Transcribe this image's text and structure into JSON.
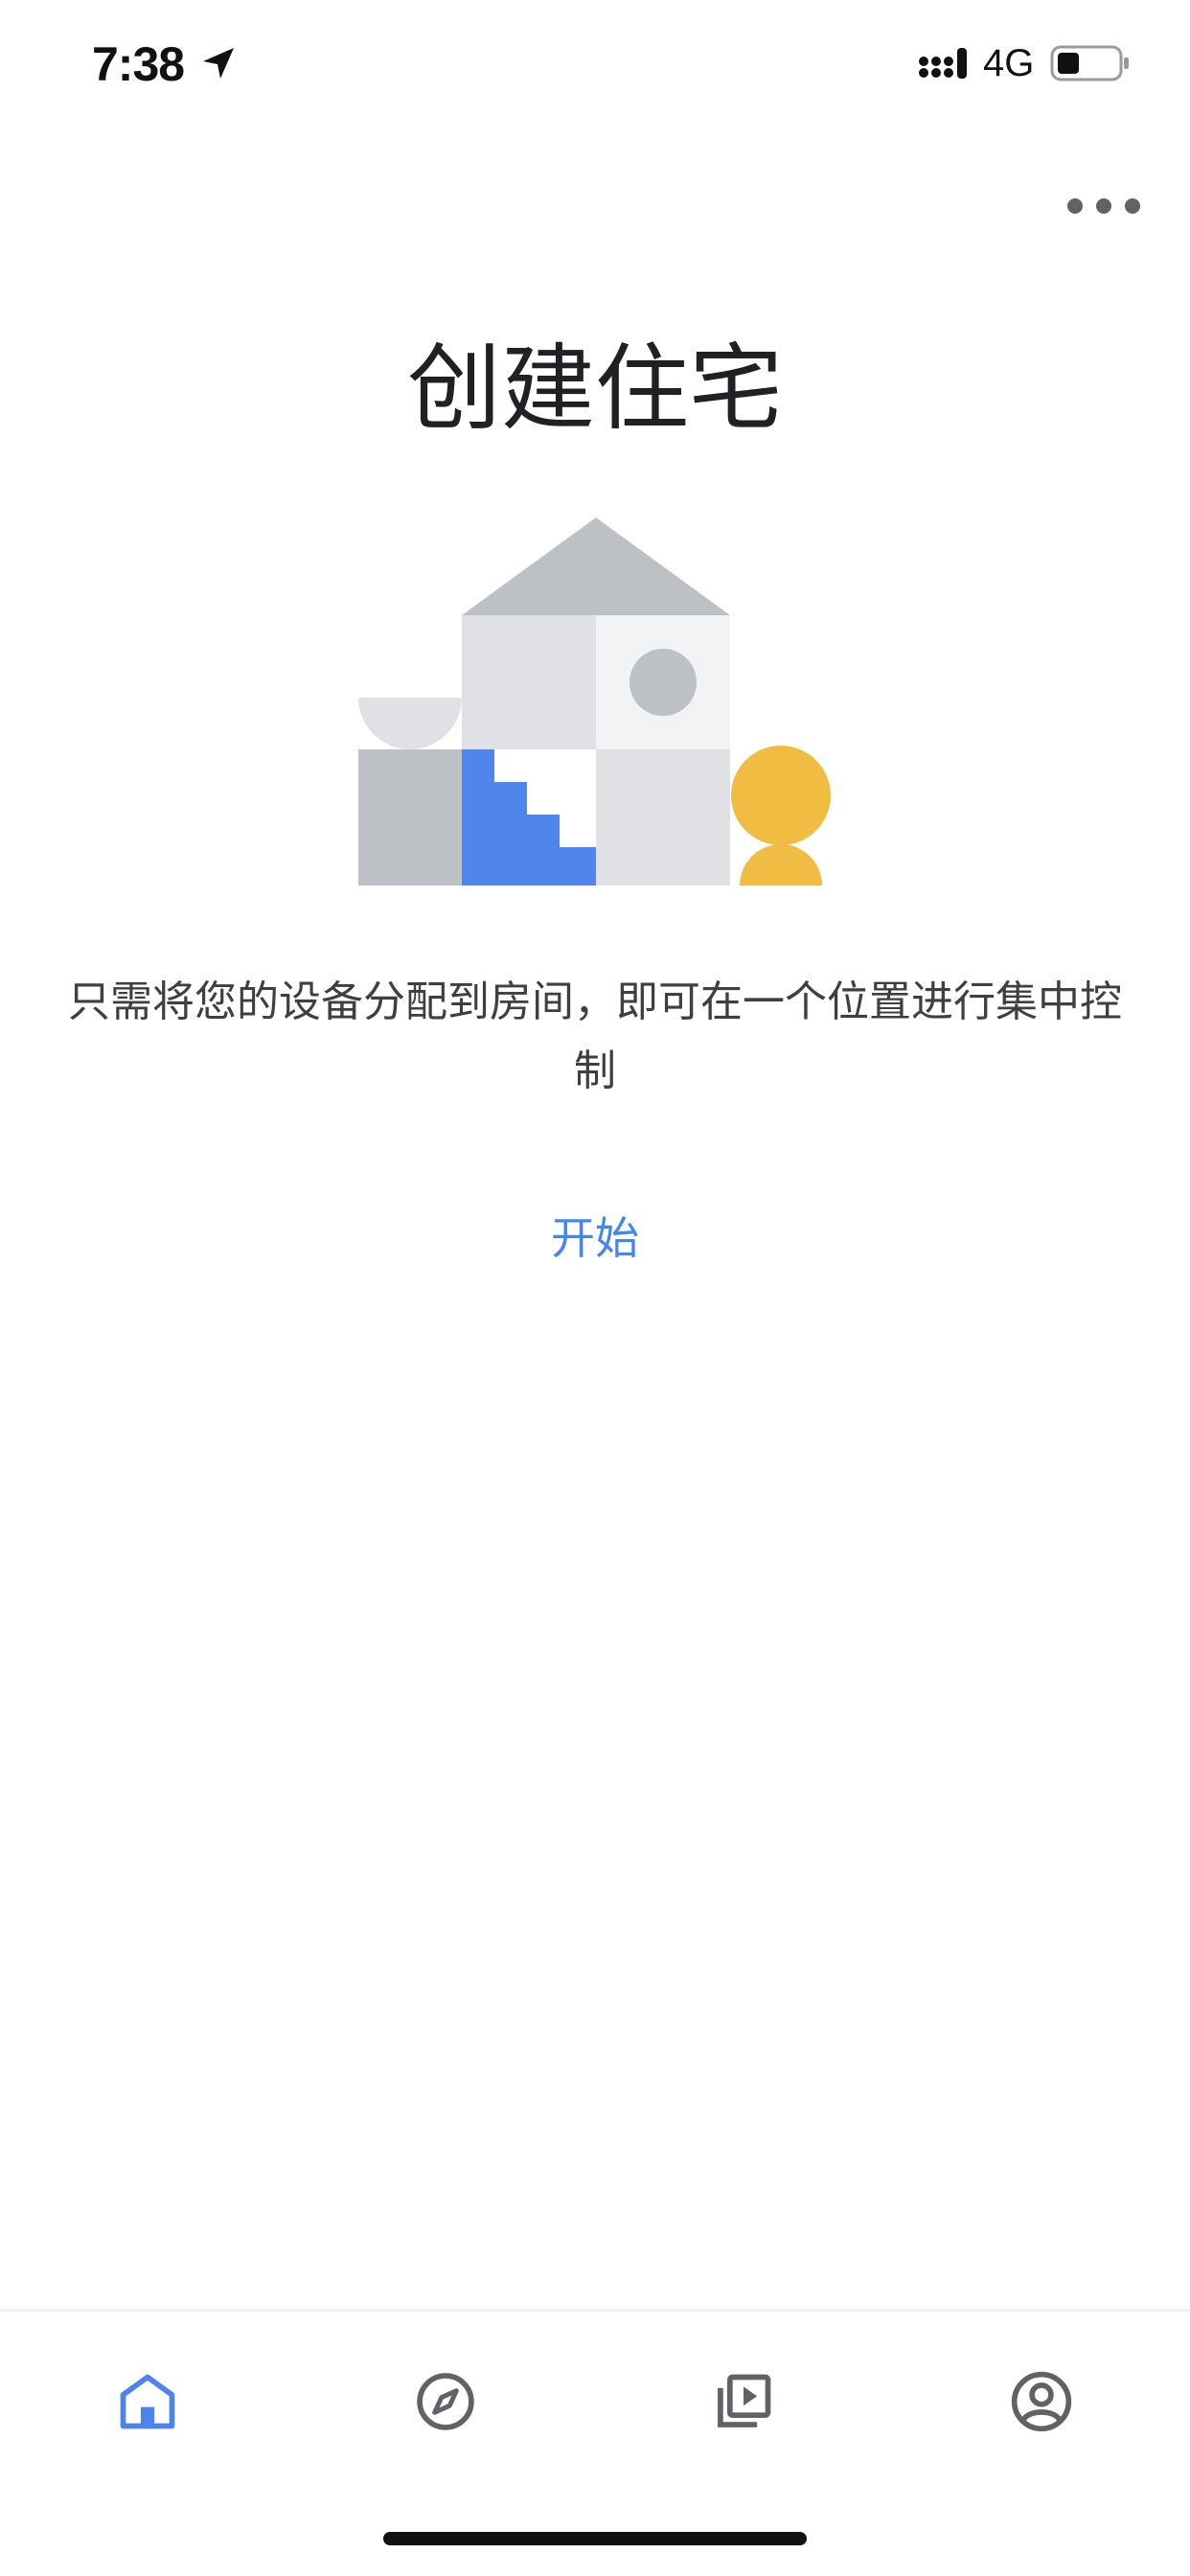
{
  "status_bar": {
    "time": "7:38",
    "network": "4G",
    "icons": [
      "location-arrow-icon",
      "signal-icon",
      "battery-icon"
    ]
  },
  "header": {
    "more_icon": "more-horizontal-icon"
  },
  "main": {
    "title": "创建住宅",
    "description": "只需将您的设备分配到房间，即可在一个位置进行集中控制",
    "start_label": "开始",
    "illustration": "house-blocks-illustration"
  },
  "bottom_nav": {
    "items": [
      {
        "icon": "home-icon",
        "active": true
      },
      {
        "icon": "compass-icon",
        "active": false
      },
      {
        "icon": "media-library-icon",
        "active": false
      },
      {
        "icon": "account-icon",
        "active": false
      }
    ]
  },
  "colors": {
    "accent": "#4285f4",
    "text_primary": "#202124",
    "text_secondary": "#3c4043",
    "icon_gray": "#5f6368",
    "illustration_gray": "#bdc1c6",
    "illustration_light": "#dfe1e5",
    "illustration_lighter": "#f1f3f4",
    "illustration_yellow": "#f0bc42"
  }
}
